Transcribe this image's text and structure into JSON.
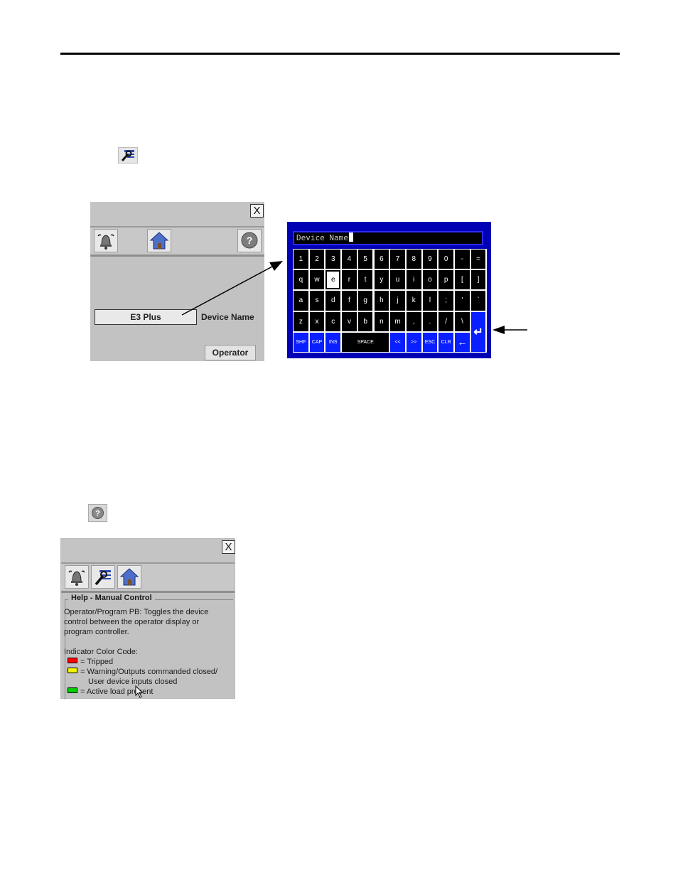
{
  "panel1": {
    "close_label": "X",
    "field_value": "E3 Plus",
    "field_label": "Device Name",
    "operator_label": "Operator",
    "icons": [
      "bell-icon",
      "home-icon",
      "help-icon"
    ]
  },
  "keyboard": {
    "input_text": "Device Name",
    "rows": [
      [
        "1",
        "2",
        "3",
        "4",
        "5",
        "6",
        "7",
        "8",
        "9",
        "0",
        "-",
        "="
      ],
      [
        "q",
        "w",
        "e",
        "r",
        "t",
        "y",
        "u",
        "i",
        "o",
        "p",
        "[",
        "]"
      ],
      [
        "a",
        "s",
        "d",
        "f",
        "g",
        "h",
        "j",
        "k",
        "l",
        ";",
        "'",
        "`"
      ],
      [
        "z",
        "x",
        "c",
        "v",
        "b",
        "n",
        "m",
        ",",
        ".",
        "/",
        "\\"
      ]
    ],
    "bottom": {
      "shf": "SHF",
      "cap": "CAP",
      "ins": "INS",
      "space": "SPACE",
      "left": "<<",
      "right": ">>",
      "esc": "ESC",
      "clr": "CLR",
      "back": "←",
      "enter": "↵"
    },
    "selected_key": "e",
    "colors": {
      "frame": "#0000b4",
      "key": "#000000",
      "function_key": "#0a1fff"
    }
  },
  "panel2": {
    "close_label": "X",
    "help_title": "Help - Manual Control",
    "help_lines": [
      "Operator/Program PB: Toggles the device",
      "control between the operator display or",
      "program controller."
    ],
    "indicator_title": "Indicator Color Code:",
    "legend": [
      {
        "color": "#ff0000",
        "text": "= Tripped"
      },
      {
        "color": "#f5f500",
        "text": "= Warning/Outputs commanded closed/"
      },
      {
        "color": "",
        "text": "User device inputs closed"
      },
      {
        "color": "#00d000",
        "text": "= Active load present"
      }
    ],
    "icons": [
      "bell-icon",
      "wrench-icon",
      "home-icon"
    ]
  }
}
